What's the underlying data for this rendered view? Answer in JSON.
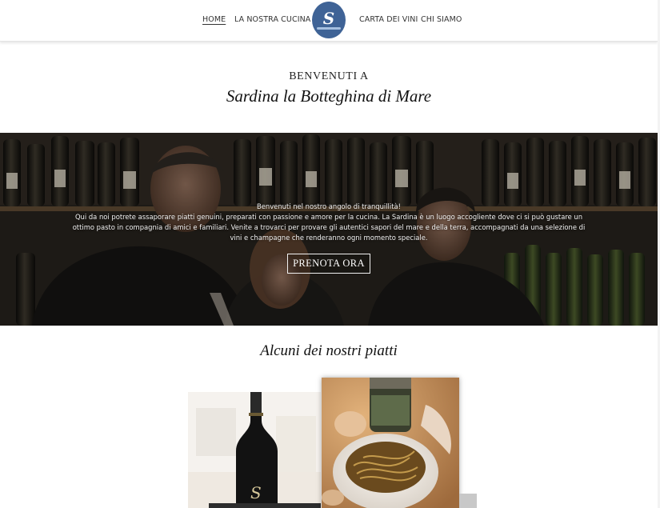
{
  "nav": {
    "items": [
      {
        "label": "HOME",
        "active": true
      },
      {
        "label": "LA NOSTRA CUCINA",
        "active": false
      },
      {
        "label": "CARTA DEI VINI",
        "active": false
      },
      {
        "label": "CHI SIAMO",
        "active": false
      }
    ],
    "logo_letter": "S"
  },
  "welcome": {
    "line1": "BENVENUTI A",
    "line2": "Sardina la Botteghina di Mare"
  },
  "hero": {
    "line1": "Benvenuti nel nostro angolo di tranquillità!",
    "line2": "Qui da noi potrete assaporare piatti genuini, preparati con passione e amore per la cucina. La Sardina è un luogo accogliente dove ci si può gustare un",
    "line3": "ottimo pasto in compagnia di amici e familiari. Venite a trovarci per provare gli autentici sapori del mare e della terra, accompagnati da una selezione di",
    "line4": "vini e champagne che renderanno ogni momento speciale.",
    "button": "PRENOTA ORA"
  },
  "dishes": {
    "title": "Alcuni dei nostri piatti",
    "bottle_label": "S"
  },
  "colors": {
    "logo_bg": "#3f6396",
    "hero_overlay": "#1b1714"
  }
}
